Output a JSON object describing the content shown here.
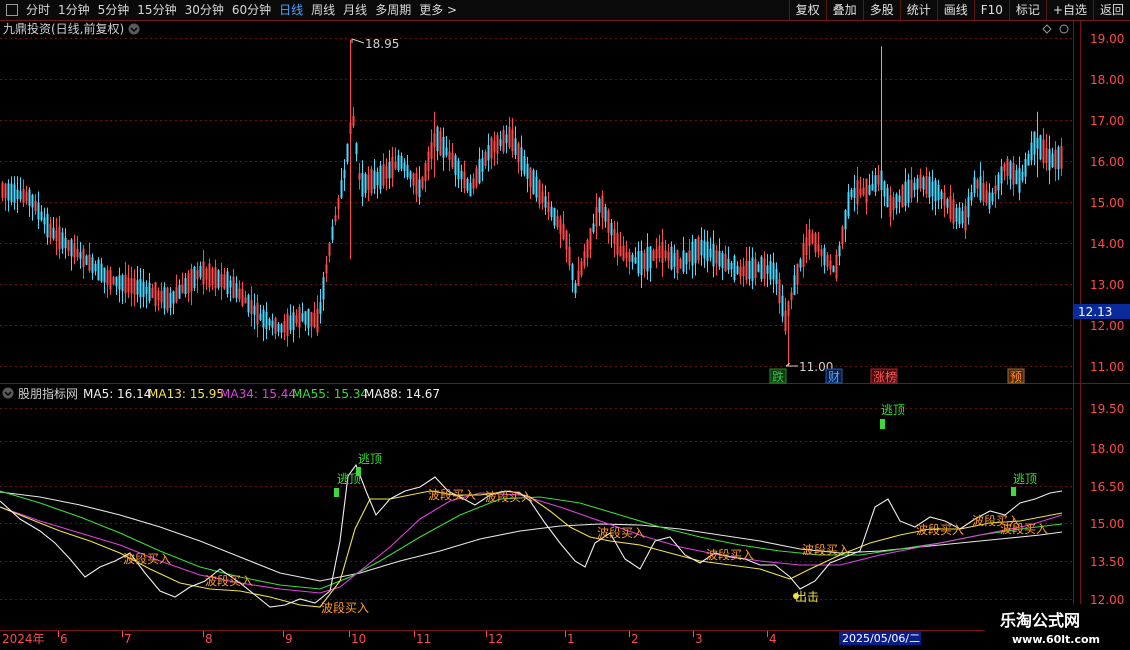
{
  "toolbar": {
    "timeframes": [
      "分时",
      "1分钟",
      "5分钟",
      "15分钟",
      "30分钟",
      "60分钟",
      "日线",
      "周线",
      "月线",
      "多周期",
      "更多 >"
    ],
    "active_timeframe": "日线",
    "buttons": [
      "复权",
      "叠加",
      "多股",
      "统计",
      "画线",
      "F10",
      "标记",
      "+自选",
      "返回"
    ]
  },
  "main_panel": {
    "title": "九鼎投资(日线,前复权)",
    "y_labels": [
      "19.00",
      "18.00",
      "17.00",
      "16.00",
      "15.00",
      "14.00",
      "13.00",
      "12.00",
      "11.00"
    ],
    "current_price": "12.13",
    "high_label": "18.95",
    "low_label": "11.00",
    "event_tags": [
      {
        "label": "跌",
        "color": "#39c24a"
      },
      {
        "label": "财",
        "color": "#4aa8ff"
      },
      {
        "label": "涨榜",
        "color": "#ff5a5a"
      },
      {
        "label": "预",
        "color": "#ff8a2a"
      }
    ]
  },
  "indicator_panel": {
    "name": "股朋指标网",
    "ma_legend": [
      {
        "label": "MA5: 16.14",
        "color": "#f0f0f0"
      },
      {
        "label": "MA13: 15.95",
        "color": "#f2e24a"
      },
      {
        "label": "MA34: 15.44",
        "color": "#e040e0"
      },
      {
        "label": "MA55: 15.34",
        "color": "#3adc3a"
      },
      {
        "label": "MA88: 14.67",
        "color": "#f0f0f0"
      }
    ],
    "y_labels": [
      "19.50",
      "18.00",
      "16.50",
      "15.00",
      "13.50",
      "12.00"
    ],
    "escape_label": "逃顶",
    "buy_label": "波段买入",
    "strike_label": "出击"
  },
  "timeline": {
    "labels": [
      "2024年",
      "6",
      "7",
      "8",
      "9",
      "10",
      "11",
      "12",
      "1",
      "2",
      "3",
      "4"
    ],
    "cursor_date": "2025/05/06/二"
  },
  "watermark": {
    "title": "乐淘公式网",
    "url": "www.60lt.com"
  },
  "colors": {
    "up": "#ff4a4a",
    "down": "#4ad8ff",
    "grid": "#7a1414"
  }
}
